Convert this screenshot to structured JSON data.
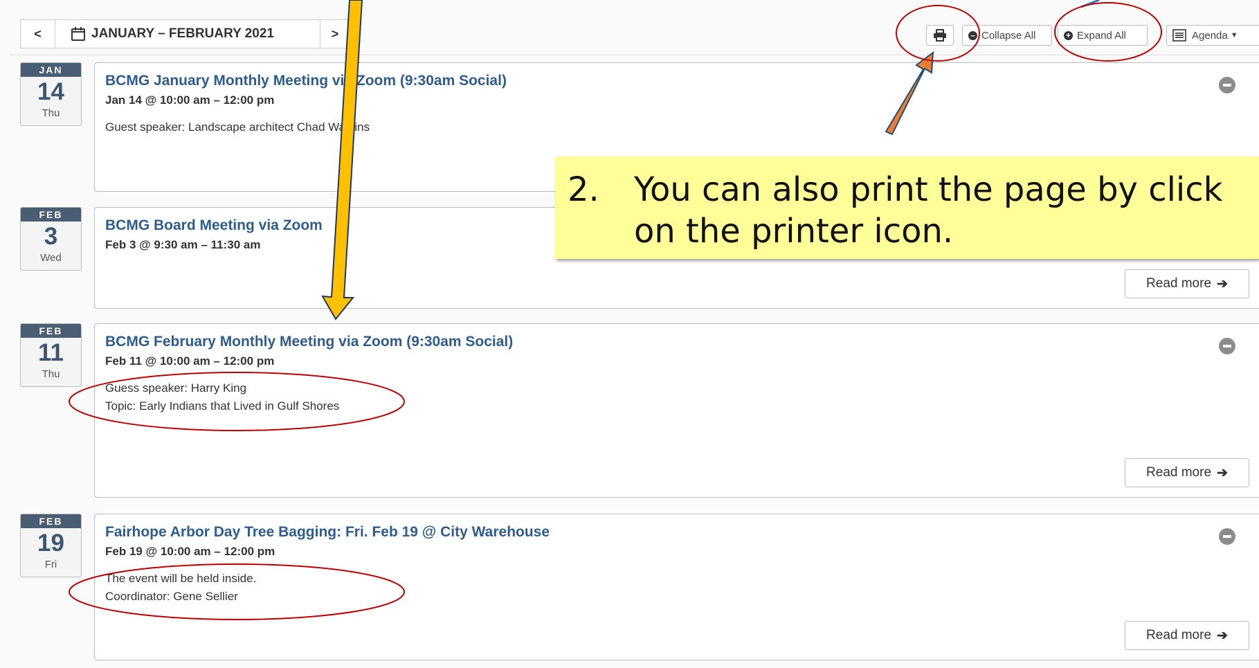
{
  "toolbar": {
    "prev_label": "<",
    "next_label": ">",
    "range_label": "JANUARY – FEBRUARY 2021",
    "collapse_all": "Collapse All",
    "expand_all": "Expand All",
    "view_label": "Agenda",
    "icons": [
      "calendar-icon",
      "printer-icon",
      "minus-circle-icon",
      "plus-circle-icon",
      "list-icon",
      "caret-down-icon"
    ]
  },
  "events": [
    {
      "month": "JAN",
      "day": "14",
      "weekday": "Thu",
      "title": "BCMG January Monthly Meeting via Zoom (9:30am Social)",
      "time": "Jan 14 @ 10:00 am – 12:00 pm",
      "desc1": "Guest speaker: Landscape architect Chad Watkins",
      "desc2": ""
    },
    {
      "month": "FEB",
      "day": "3",
      "weekday": "Wed",
      "title": "BCMG Board Meeting via Zoom",
      "time": "Feb 3 @ 9:30 am – 11:30 am",
      "read_more": "Read more"
    },
    {
      "month": "FEB",
      "day": "11",
      "weekday": "Thu",
      "title": "BCMG February Monthly Meeting via Zoom (9:30am Social)",
      "time": "Feb 11 @ 10:00 am – 12:00 pm",
      "desc1": "Guess speaker: Harry King",
      "desc2": "Topic: Early Indians that Lived in Gulf Shores",
      "read_more": "Read more"
    },
    {
      "month": "FEB",
      "day": "19",
      "weekday": "Fri",
      "title": "Fairhope Arbor Day Tree Bagging: Fri. Feb 19 @ City Warehouse",
      "time": "Feb 19 @ 10:00 am – 12:00 pm",
      "desc1": "The event will be held inside.",
      "desc2": "Coordinator: Gene Sellier",
      "read_more": "Read more"
    }
  ],
  "annotation": {
    "number": "2.",
    "line1": "You can also print the page by click",
    "line2": "on the printer icon."
  },
  "colors": {
    "title_blue": "#2f5c8f",
    "badge_header": "#4a5d73",
    "callout_yellow": "#ffff99",
    "annotation_red": "#c00000",
    "arrow_orange": "#ed7d31",
    "arrow_gold": "#ffc000"
  }
}
